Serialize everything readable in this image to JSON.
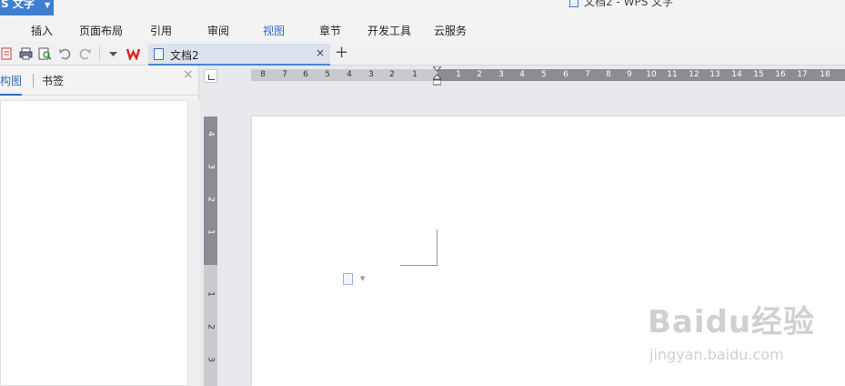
{
  "app": {
    "menu_label": "S 文字",
    "window_title": "文档2 - WPS 文字"
  },
  "ribbon": {
    "tabs": [
      {
        "label": "插入"
      },
      {
        "label": "页面布局"
      },
      {
        "label": "引用"
      },
      {
        "label": "审阅"
      },
      {
        "label": "视图"
      },
      {
        "label": "章节"
      },
      {
        "label": "开发工具"
      },
      {
        "label": "云服务"
      }
    ],
    "active_tab": "视图"
  },
  "doc_tab": {
    "label": "文档2",
    "close": "×"
  },
  "new_tab": "+",
  "nav_pane": {
    "tab_outline": "构图",
    "tab_bookmarks": "书签",
    "close": "×"
  },
  "ruler": {
    "h_labels": [
      "8",
      "7",
      "6",
      "5",
      "4",
      "3",
      "2",
      "1",
      "1",
      "2",
      "3",
      "4",
      "5",
      "6",
      "7",
      "8",
      "9",
      "10",
      "11",
      "12",
      "13",
      "14",
      "15",
      "16",
      "17",
      "18"
    ],
    "v_labels": [
      "4",
      "3",
      "2",
      "1",
      "1",
      "2",
      "3"
    ]
  },
  "watermark": {
    "main": "Baidu经验",
    "url": "jingyan.baidu.com"
  },
  "colors": {
    "accent": "#3c7fd1",
    "ruler": "#8b8d92",
    "page": "#ffffff"
  }
}
